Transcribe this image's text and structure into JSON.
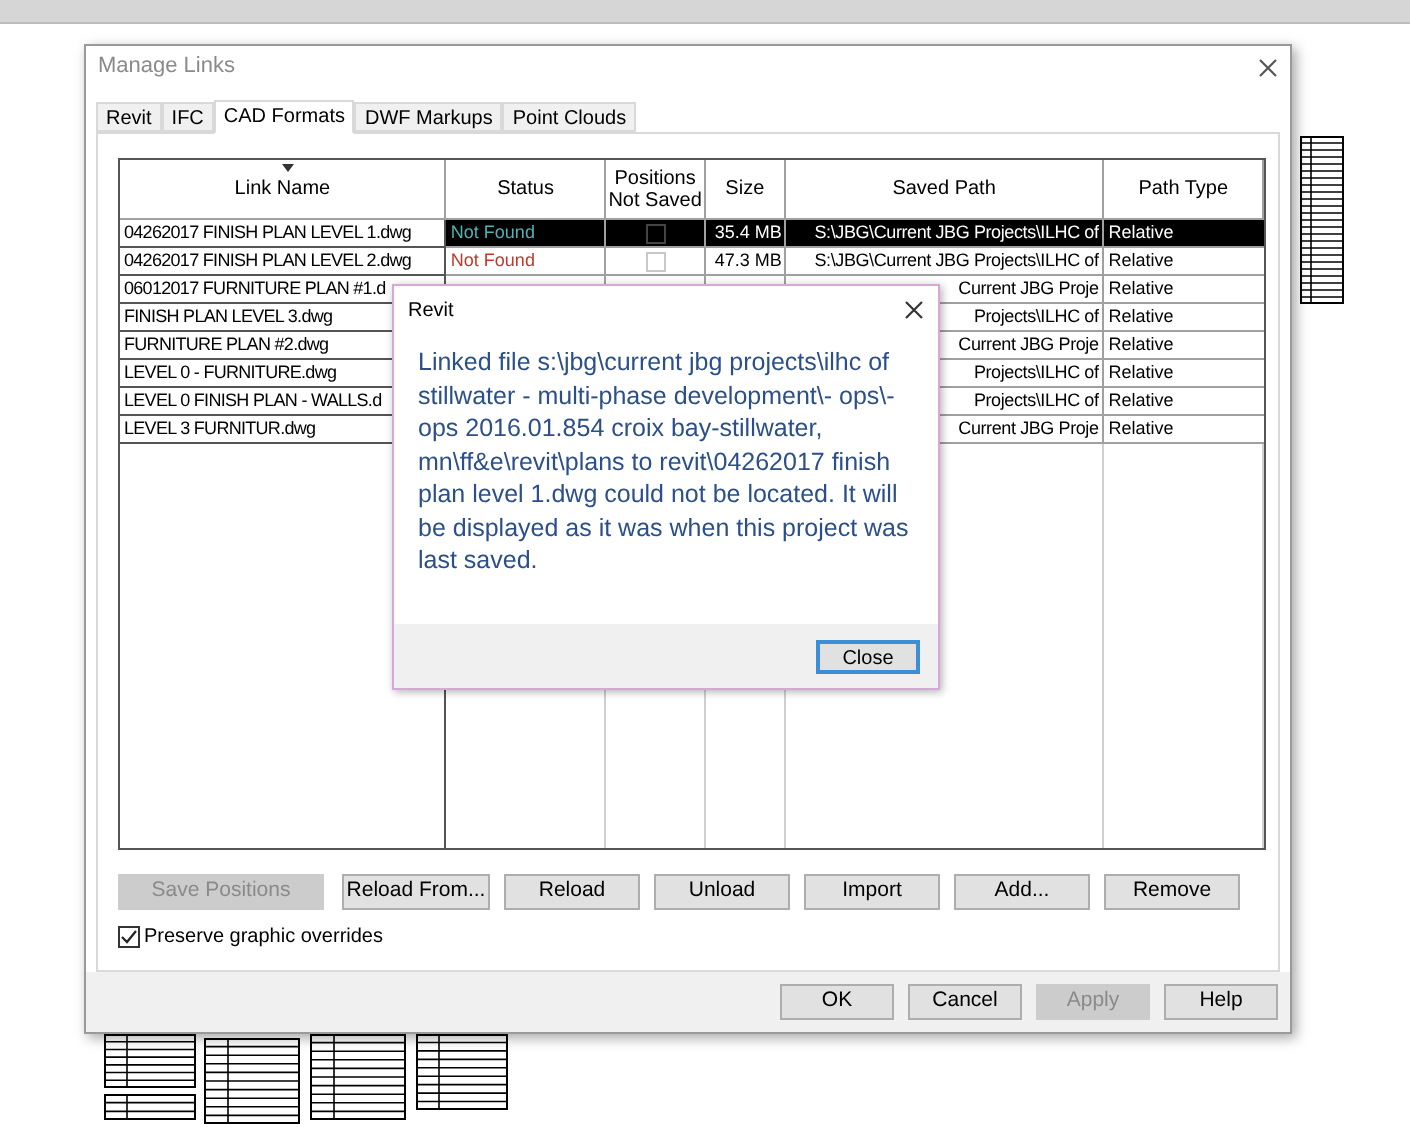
{
  "dialog": {
    "title": "Manage Links"
  },
  "tabs": [
    {
      "label": "Revit",
      "selected": false
    },
    {
      "label": "IFC",
      "selected": false
    },
    {
      "label": "CAD Formats",
      "selected": true
    },
    {
      "label": "DWF Markups",
      "selected": false
    },
    {
      "label": "Point Clouds",
      "selected": false
    }
  ],
  "table": {
    "columns": [
      "Link Name",
      "Status",
      "Positions Not Saved",
      "Size",
      "Saved Path",
      "Path Type"
    ],
    "rows": [
      {
        "link_name": "04262017 FINISH PLAN LEVEL 1.dwg",
        "status": "Not Found",
        "positions_not_saved": false,
        "size": "35.4 MB",
        "saved_path": "S:\\JBG\\Current JBG Projects\\ILHC of",
        "path_type": "Relative",
        "selected": true
      },
      {
        "link_name": "04262017 FINISH PLAN LEVEL 2.dwg",
        "status": "Not Found",
        "positions_not_saved": false,
        "size": "47.3 MB",
        "saved_path": "S:\\JBG\\Current JBG Projects\\ILHC of",
        "path_type": "Relative",
        "selected": false
      },
      {
        "link_name": "06012017 FURNITURE PLAN #1.d",
        "saved_path": "Current JBG Proje",
        "path_type": "Relative",
        "selected": false
      },
      {
        "link_name": "FINISH PLAN LEVEL 3.dwg",
        "saved_path": "Projects\\ILHC of",
        "path_type": "Relative",
        "selected": false
      },
      {
        "link_name": "FURNITURE PLAN #2.dwg",
        "saved_path": "Current JBG Proje",
        "path_type": "Relative",
        "selected": false
      },
      {
        "link_name": "LEVEL 0 - FURNITURE.dwg",
        "saved_path": "Projects\\ILHC of",
        "path_type": "Relative",
        "selected": false
      },
      {
        "link_name": "LEVEL 0 FINISH PLAN - WALLS.d",
        "saved_path": "Projects\\ILHC of",
        "path_type": "Relative",
        "selected": false
      },
      {
        "link_name": "LEVEL 3 FURNITUR.dwg",
        "saved_path": "Current JBG Proje",
        "path_type": "Relative",
        "selected": false
      }
    ]
  },
  "buttons": [
    {
      "label": "Save Positions",
      "disabled": true
    },
    {
      "label": "Reload From...",
      "disabled": false
    },
    {
      "label": "Reload",
      "disabled": false
    },
    {
      "label": "Unload",
      "disabled": false
    },
    {
      "label": "Import",
      "disabled": false
    },
    {
      "label": "Add...",
      "disabled": false
    },
    {
      "label": "Remove",
      "disabled": false
    }
  ],
  "preserve_overrides": {
    "label": "Preserve graphic overrides",
    "checked": true
  },
  "footer_buttons": [
    {
      "label": "OK",
      "disabled": false
    },
    {
      "label": "Cancel",
      "disabled": false
    },
    {
      "label": "Apply",
      "disabled": true
    },
    {
      "label": "Help",
      "disabled": false
    }
  ],
  "message_box": {
    "title": "Revit",
    "message": "Linked file s:\\jbg\\current jbg projects\\ilhc of stillwater - multi-phase development\\- ops\\-ops 2016.01.854 croix bay-stillwater, mn\\ff&e\\revit\\plans to revit\\04262017 finish plan level 1.dwg could not be located. It will be displayed as it was when this project was last saved.",
    "button": "Close"
  }
}
